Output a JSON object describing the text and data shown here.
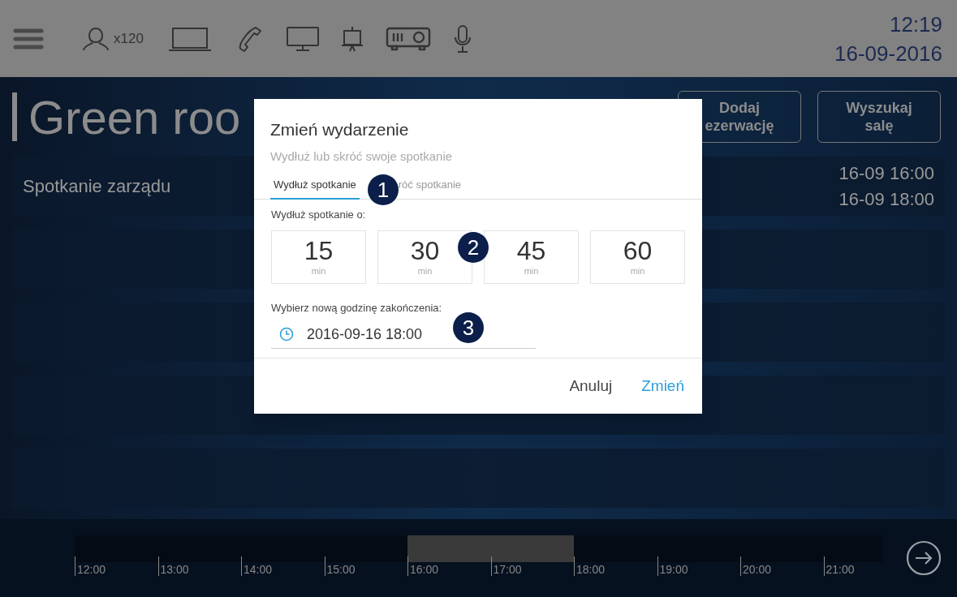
{
  "top_bar": {
    "capacity": "x120",
    "time": "12:19",
    "date": "16-09-2016"
  },
  "room": {
    "title": "Green roo",
    "buttons": [
      {
        "lines": [
          "Dodaj",
          "ezerwację"
        ]
      },
      {
        "lines": [
          "Wyszukaj",
          "salę"
        ]
      }
    ]
  },
  "meetings": [
    {
      "name": "Spotkanie zarządu",
      "start": "16-09 16:00",
      "end": "16-09 18:00"
    }
  ],
  "dialog": {
    "title": "Zmień wydarzenie",
    "subtitle": "Wydłuż lub skróć swoje spotkanie",
    "tabs": [
      {
        "label": "Wydłuż spotkanie",
        "selected": true
      },
      {
        "label": "róć spotkanie",
        "selected": false
      }
    ],
    "extend_label": "Wydłuż spotkanie o:",
    "durations": [
      {
        "value": "15",
        "unit": "min"
      },
      {
        "value": "30",
        "unit": "min"
      },
      {
        "value": "45",
        "unit": "min"
      },
      {
        "value": "60",
        "unit": "min"
      }
    ],
    "end_label": "Wybierz nową godzinę zakończenia:",
    "end_value": "2016-09-16 18:00",
    "buttons": [
      {
        "label": "Anuluj",
        "kind": "secondary"
      },
      {
        "label": "Zmień",
        "kind": "primary"
      }
    ]
  },
  "callouts": [
    "1",
    "2",
    "3"
  ],
  "timeline": {
    "ticks": [
      {
        "label": "12:00",
        "booked": false
      },
      {
        "label": "13:00",
        "booked": false
      },
      {
        "label": "14:00",
        "booked": false
      },
      {
        "label": "15:00",
        "booked": false
      },
      {
        "label": "16:00",
        "booked": true
      },
      {
        "label": "17:00",
        "booked": true
      },
      {
        "label": "18:00",
        "booked": false
      },
      {
        "label": "19:00",
        "booked": false
      },
      {
        "label": "20:00",
        "booked": false
      },
      {
        "label": "21:00",
        "booked": false
      }
    ]
  }
}
